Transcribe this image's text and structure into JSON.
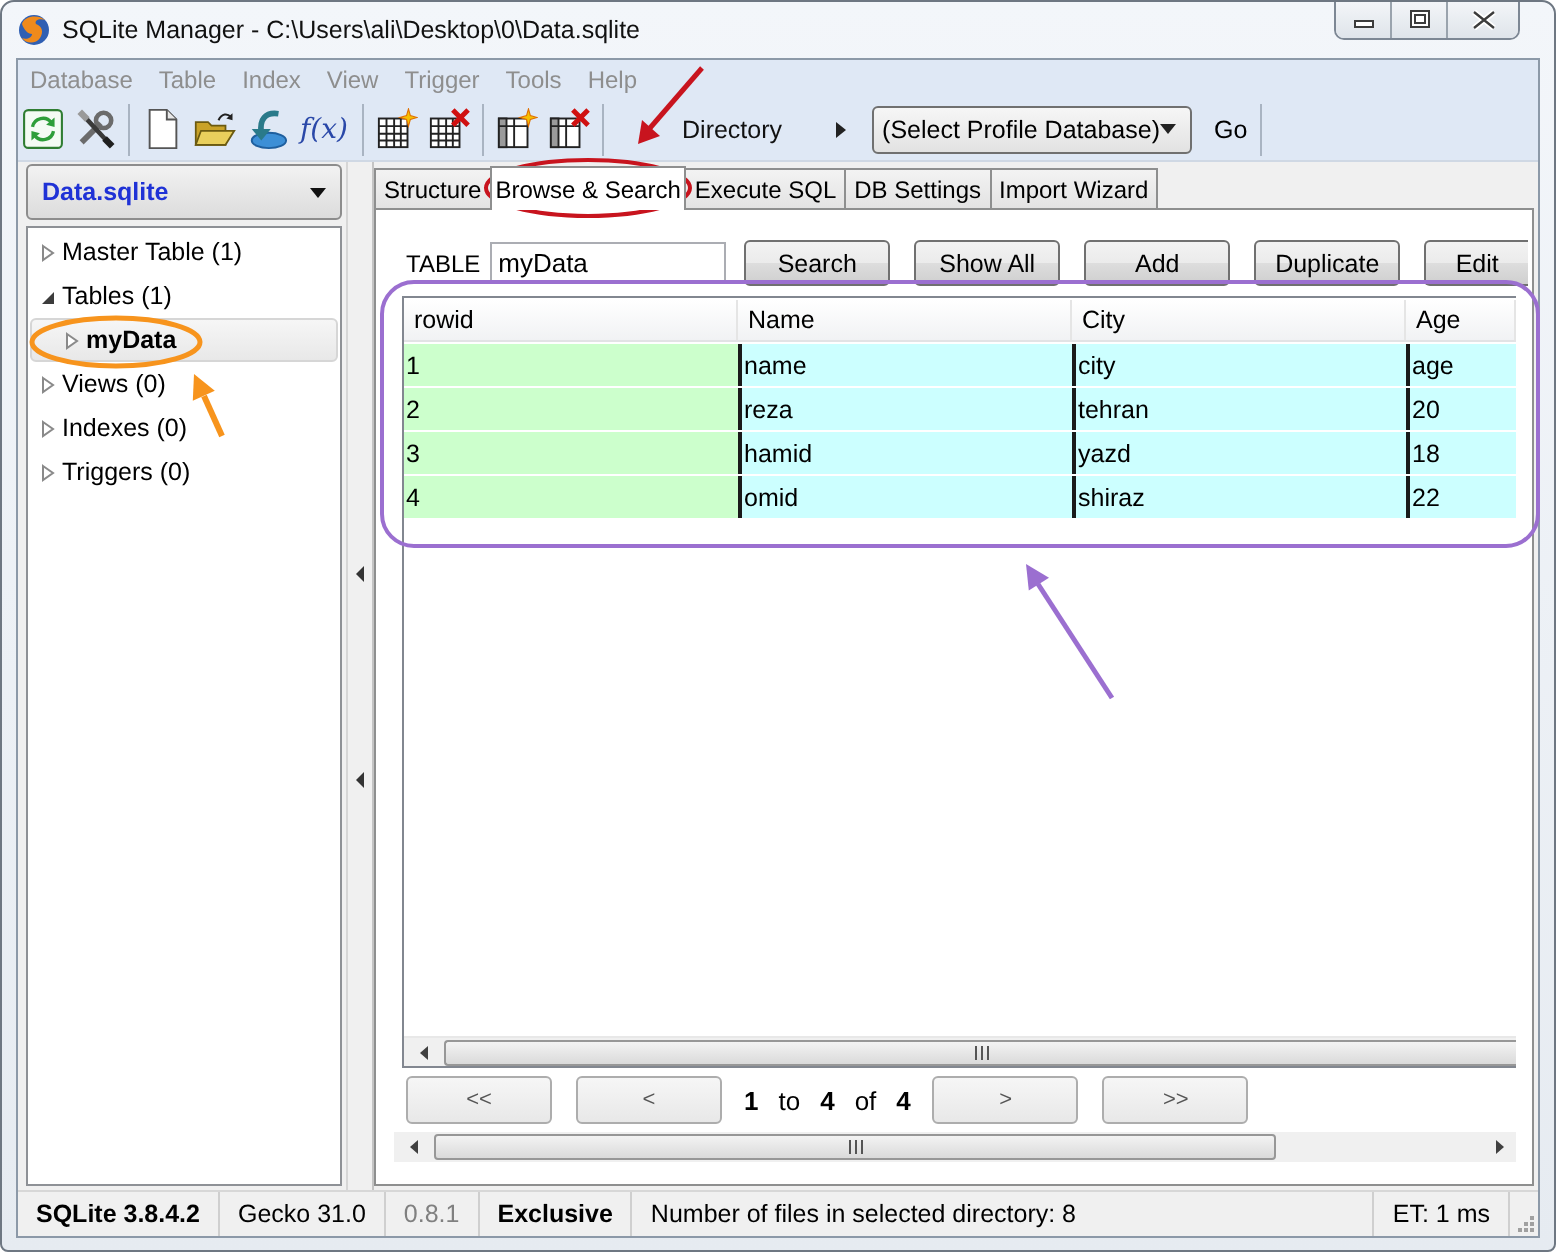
{
  "window": {
    "title": "SQLite Manager - C:\\Users\\ali\\Desktop\\0\\Data.sqlite"
  },
  "menu_bar": [
    {
      "label": "Database",
      "disabled": true
    },
    {
      "label": "Table",
      "disabled": true
    },
    {
      "label": "Index",
      "disabled": true
    },
    {
      "label": "View",
      "disabled": true
    },
    {
      "label": "Trigger",
      "disabled": true
    },
    {
      "label": "Tools",
      "disabled": true
    },
    {
      "label": "Help",
      "disabled": true
    }
  ],
  "toolbar": {
    "function_button": "f(x)",
    "directory_label": "Directory",
    "profile_select": {
      "value": "(Select Profile Database)"
    },
    "go_button": "Go"
  },
  "sidebar": {
    "database_select": {
      "value": "Data.sqlite"
    },
    "tree": [
      {
        "label": "Master Table (1)",
        "expanded": false,
        "selected": false
      },
      {
        "label": "Tables (1)",
        "expanded": true,
        "selected": false,
        "children": [
          {
            "label": "myData",
            "expanded": false,
            "selected": true
          }
        ]
      },
      {
        "label": "Views (0)",
        "expanded": false,
        "selected": false
      },
      {
        "label": "Indexes (0)",
        "expanded": false,
        "selected": false
      },
      {
        "label": "Triggers (0)",
        "expanded": false,
        "selected": false
      }
    ]
  },
  "tabs": [
    {
      "label": "Structure",
      "selected": false
    },
    {
      "label": "Browse & Search",
      "selected": true
    },
    {
      "label": "Execute SQL",
      "selected": false
    },
    {
      "label": "DB Settings",
      "selected": false
    },
    {
      "label": "Import Wizard",
      "selected": false
    }
  ],
  "browse": {
    "table_label": "TABLE",
    "table_field": {
      "value": "myData"
    },
    "buttons": [
      "Search",
      "Show All",
      "Add",
      "Duplicate",
      "Edit"
    ],
    "table": {
      "columns": [
        "rowid",
        "Name",
        "City",
        "Age"
      ],
      "rows": [
        [
          "1",
          "name",
          "city",
          "age"
        ],
        [
          "2",
          "reza",
          "tehran",
          "20"
        ],
        [
          "3",
          "hamid",
          "yazd",
          "18"
        ],
        [
          "4",
          "omid",
          "shiraz",
          "22"
        ]
      ]
    },
    "pager": {
      "first_button": "<<",
      "previous_button": "<",
      "from": "1",
      "to_label": "to",
      "to": "4",
      "of_label": "of",
      "total": "4",
      "next_button": ">",
      "last_button": ">>"
    }
  },
  "status_bar": [
    {
      "text": "SQLite 3.8.4.2",
      "kind": "bold"
    },
    {
      "text": "Gecko 31.0",
      "kind": "plain"
    },
    {
      "text": "0.8.1",
      "kind": "muted"
    },
    {
      "text": "Exclusive",
      "kind": "bold"
    },
    {
      "text": "Number of files in selected directory: 8",
      "kind": "plain"
    },
    {
      "text": "ET: 1 ms",
      "kind": "plain"
    }
  ]
}
